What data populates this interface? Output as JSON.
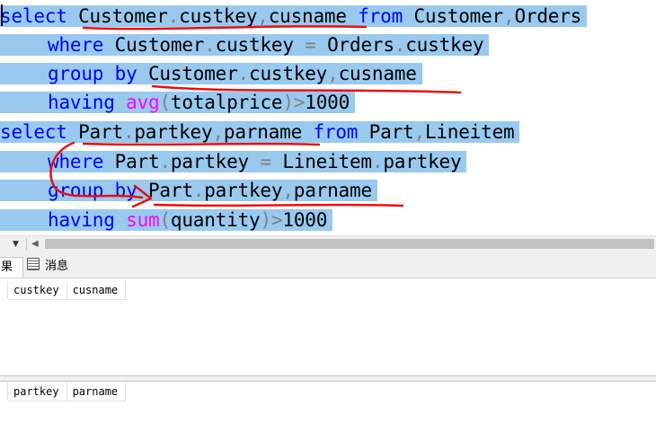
{
  "editor": {
    "line1": {
      "kw1": "select",
      "t1": " Customer",
      "d1": ".",
      "t2": "custkey",
      "d2": ",",
      "t3": "cusname ",
      "kw2": "from",
      "t4": " Customer",
      "d3": ",",
      "t5": "Orders"
    },
    "line2": {
      "kw1": "where",
      "t1": " Customer",
      "d1": ".",
      "t2": "custkey ",
      "d2": "=",
      "t3": " Orders",
      "d3": ".",
      "t4": "custkey"
    },
    "line3": {
      "kw1": "group by",
      "t1": " Customer",
      "d1": ".",
      "t2": "custkey",
      "d2": ",",
      "t3": "cusname"
    },
    "line4": {
      "kw1": "having",
      "t0": " ",
      "fn": "avg",
      "p1": "(",
      "t1": "totalprice",
      "p2": ")",
      "op": ">",
      "t2": "1000"
    },
    "line5": {
      "kw1": "select",
      "t1": " Part",
      "d1": ".",
      "t2": "partkey",
      "d2": ",",
      "t3": "parname ",
      "kw2": "from",
      "t4": " Part",
      "d3": ",",
      "t5": "Lineitem"
    },
    "line6": {
      "kw1": "where",
      "t1": " Part",
      "d1": ".",
      "t2": "partkey ",
      "d2": "=",
      "t3": " Lineitem",
      "d3": ".",
      "t4": "partkey"
    },
    "line7": {
      "kw1": "group by",
      "t1": " Part",
      "d1": ".",
      "t2": "partkey",
      "d2": ",",
      "t3": "parname"
    },
    "line8": {
      "kw1": "having",
      "t0": " ",
      "fn": "sum",
      "p1": "(",
      "t1": "quantity",
      "p2": ")",
      "op": ">",
      "t2": "1000"
    }
  },
  "tabs": {
    "results_label": "果",
    "messages_label": "消息"
  },
  "grid1": {
    "columns": [
      "custkey",
      "cusname"
    ]
  },
  "grid2": {
    "columns": [
      "partkey",
      "parname"
    ]
  },
  "colors": {
    "selection": "#99c9ef",
    "keyword": "#0000ff",
    "function": "#ff00ff",
    "operator": "#808080",
    "annotation": "#e81010"
  },
  "icons": {
    "messages_tab": "messages-icon",
    "scroll_dropdown": "dropdown-arrow-icon",
    "scroll_left": "scroll-left-arrow-icon"
  }
}
